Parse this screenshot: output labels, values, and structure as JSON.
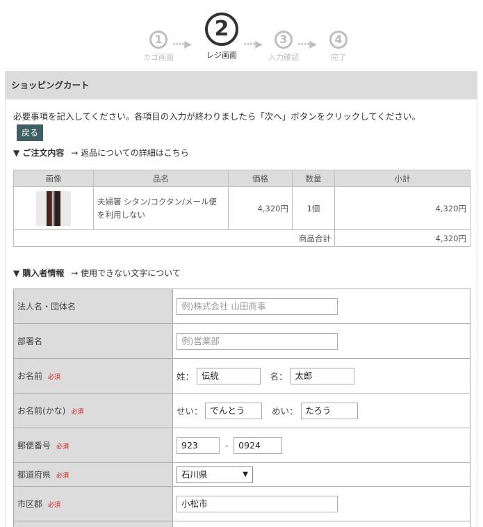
{
  "steps": [
    {
      "num": "1",
      "label": "カゴ画面"
    },
    {
      "num": "2",
      "label": "レジ画面"
    },
    {
      "num": "3",
      "label": "入力確認"
    },
    {
      "num": "4",
      "label": "完了"
    }
  ],
  "arrow": "····▶",
  "cart": {
    "title": "ショッピングカート",
    "intro": "必要事項を記入してください。各項目の入力が終わりましたら「次へ」ボタンをクリックしてください。",
    "back_label": "戻る"
  },
  "order": {
    "heading": "▼ ご注文内容",
    "link": "→ 返品についての詳細はこちら",
    "columns": [
      "画像",
      "品名",
      "価格",
      "数量",
      "小計"
    ],
    "row": {
      "name": "夫婦箸 シタン/コクタン/メール便を利用しない",
      "price": "4,320円",
      "qty": "1個",
      "subtotal": "4,320円"
    },
    "total_label": "商品合計",
    "total_value": "4,320円"
  },
  "buyer": {
    "heading": "▼ 購入者情報",
    "link": "→ 使用できない文字について",
    "required": "必須",
    "company_label": "法人名・団体名",
    "company_placeholder": "例)株式会社 山田商事",
    "dept_label": "部署名",
    "dept_placeholder": "例)営業部",
    "name_label": "お名前",
    "sei_label": "姓：",
    "sei_value": "伝統",
    "mei_label": "名：",
    "mei_value": "太郎",
    "kana_label": "お名前(かな)",
    "sei_kana_label": "せい：",
    "sei_kana_value": "でんとう",
    "mei_kana_label": "めい：",
    "mei_kana_value": "たろう",
    "zip_label": "郵便番号",
    "zip1": "923",
    "zip_sep": "-",
    "zip2": "0924",
    "pref_label": "都道府県",
    "pref_value": "石川県",
    "city_label": "市区郡",
    "city_value": "小松市"
  }
}
